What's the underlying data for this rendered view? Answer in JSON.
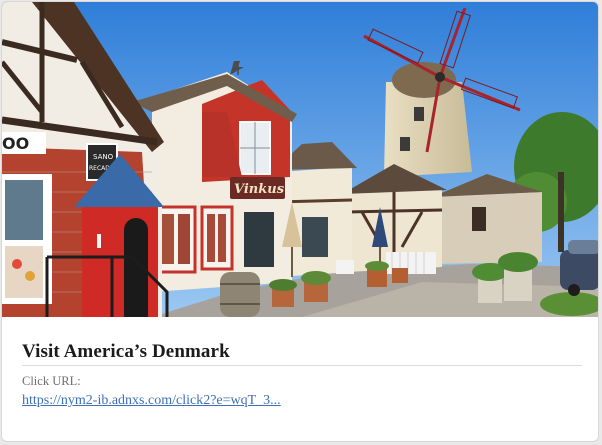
{
  "card": {
    "title": "Visit America’s Denmark",
    "click_url_label": "Click URL:",
    "click_url": "https://nym2-ib.adnxs.com/click2?e=wqT_3..."
  },
  "image": {
    "signs": {
      "shop_sign_line1": "SANO",
      "shop_sign_line2": "RECADO",
      "vinkus_sign": "Vinkus",
      "edge_sign": "OO"
    }
  },
  "colors": {
    "title": "#1b1b1b",
    "label": "#6e6e6e",
    "link": "#3c6fb6",
    "sky": "#4b8fe0",
    "brick": "#b3422f",
    "red_trim": "#c3271f"
  }
}
